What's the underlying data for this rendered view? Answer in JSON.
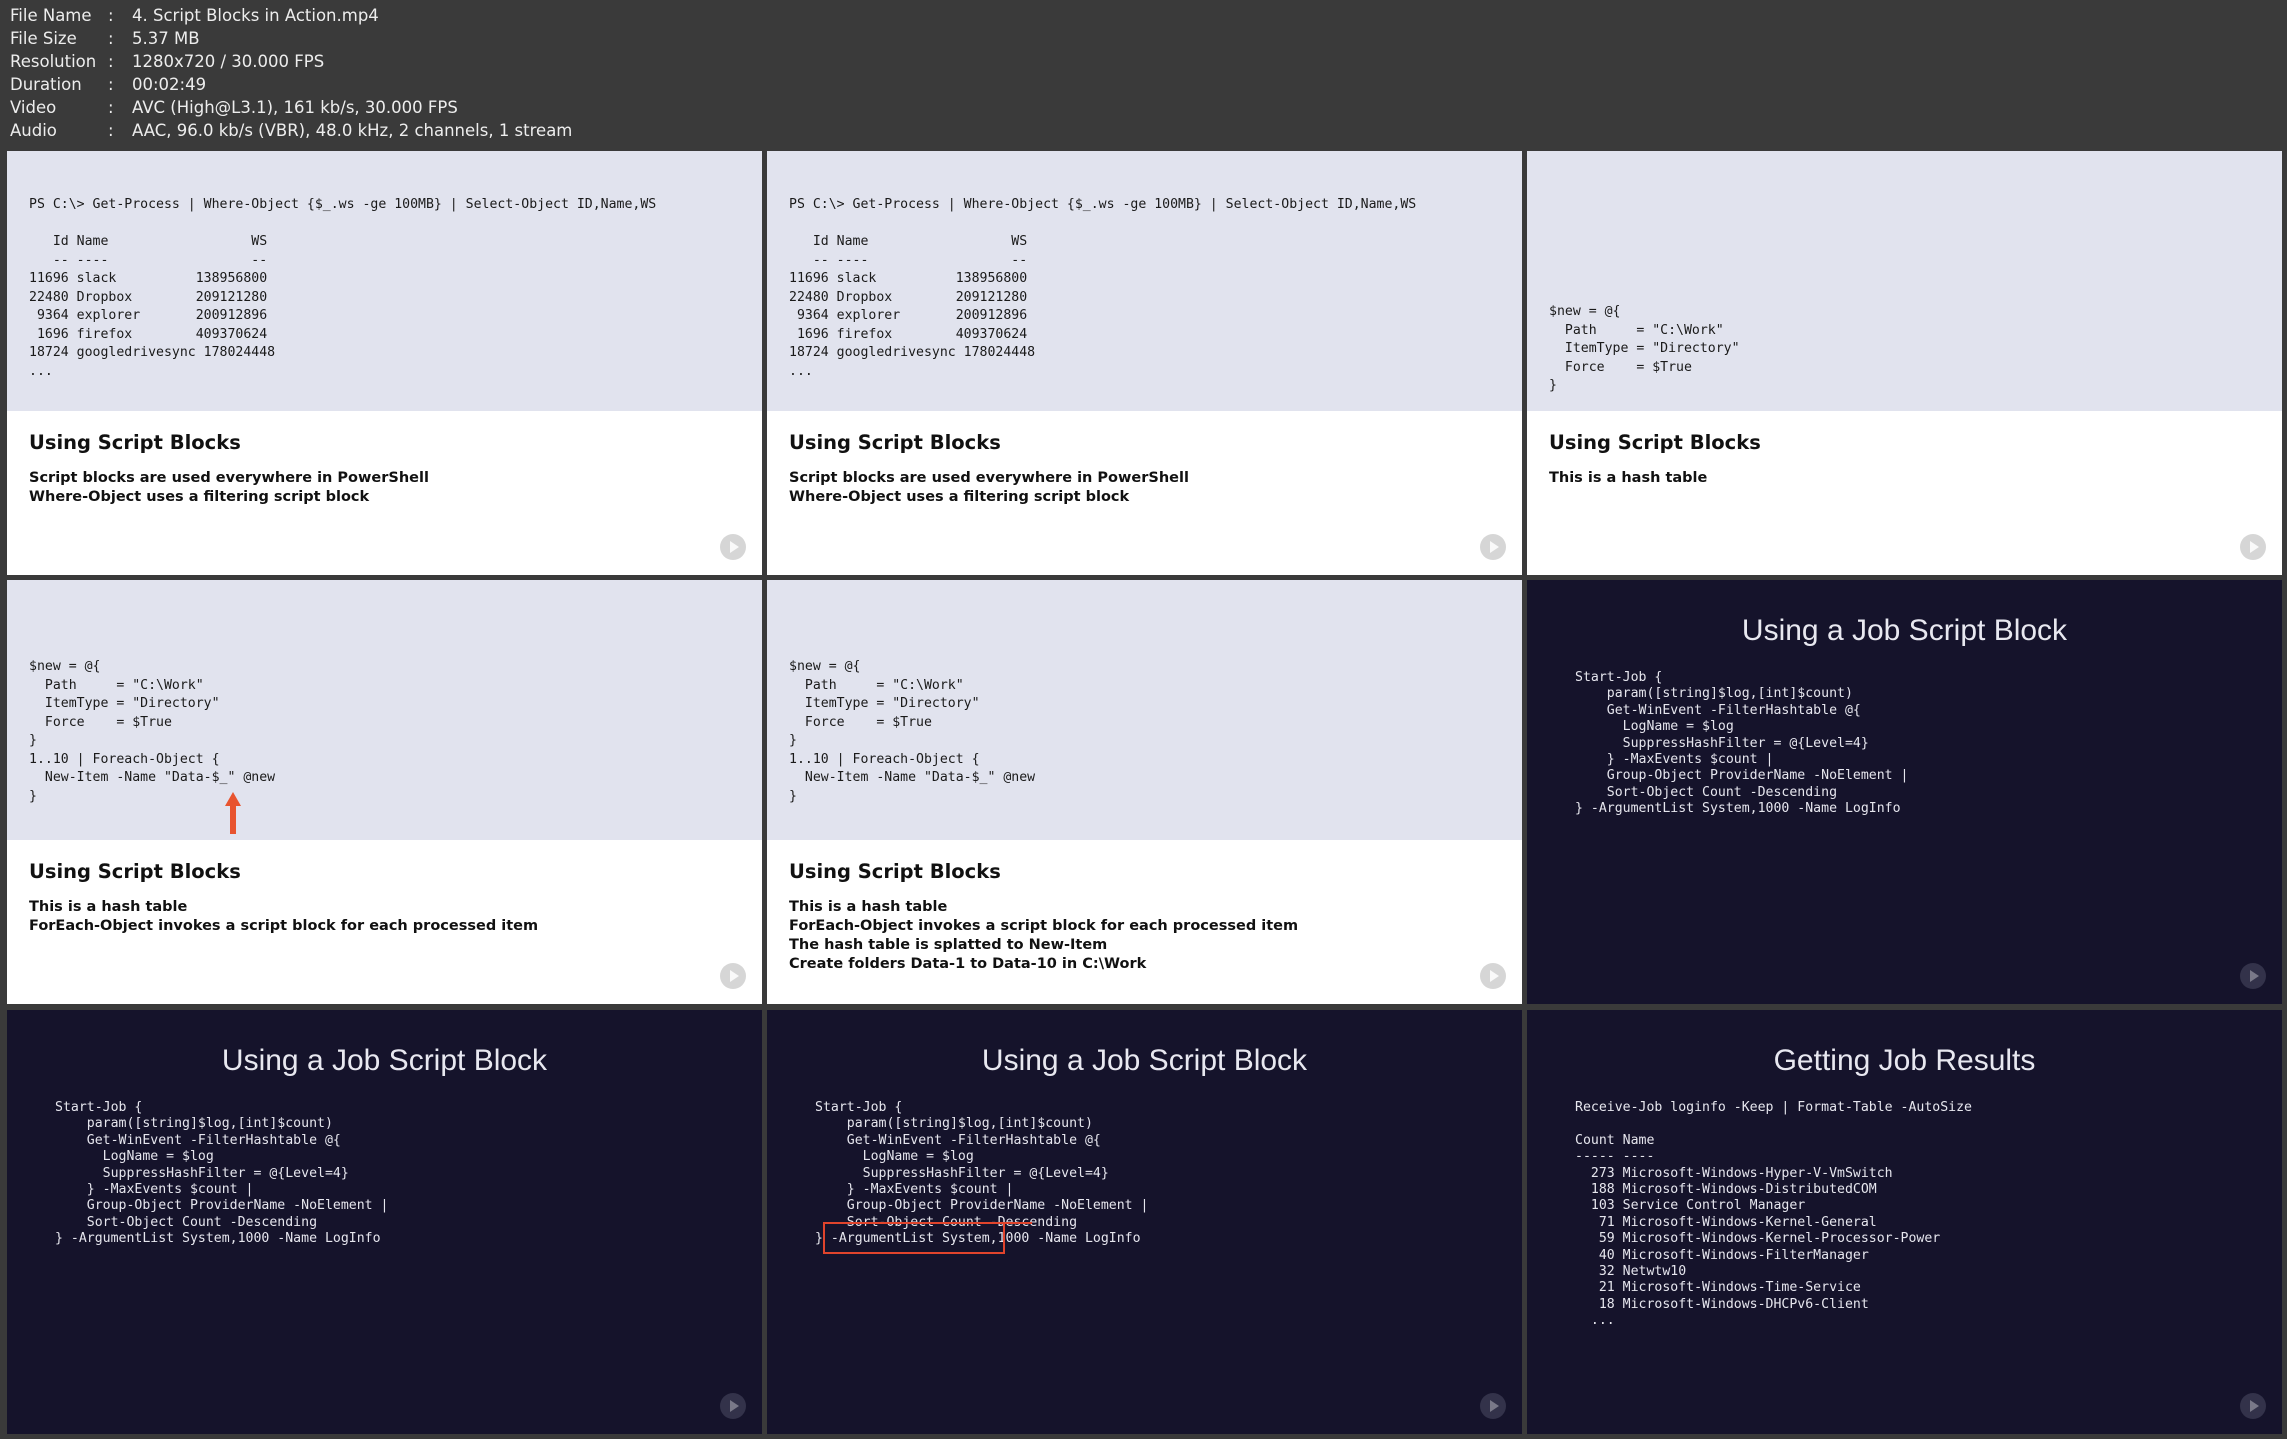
{
  "meta": {
    "rows": [
      {
        "key": "File Name",
        "value": "4. Script Blocks in Action.mp4"
      },
      {
        "key": "File Size",
        "value": "5.37 MB"
      },
      {
        "key": "Resolution",
        "value": "1280x720 / 30.000 FPS"
      },
      {
        "key": "Duration",
        "value": "00:02:49"
      },
      {
        "key": "Video",
        "value": "AVC (High@L3.1), 161 kb/s, 30.000 FPS"
      },
      {
        "key": "Audio",
        "value": "AAC, 96.0 kb/s (VBR), 48.0 kHz, 2 channels, 1 stream"
      }
    ]
  },
  "frames": {
    "f1": {
      "code": "PS C:\\> Get-Process | Where-Object {$_.ws -ge 100MB} | Select-Object ID,Name,WS\n\n   Id Name                  WS\n   -- ----                  --\n11696 slack          138956800\n22480 Dropbox        209121280\n 9364 explorer       200912896\n 1696 firefox        409370624\n18724 googledrivesync 178024448\n...",
      "title": "Using Script Blocks",
      "bullets": "Script blocks are used everywhere in PowerShell\nWhere-Object uses a filtering script block"
    },
    "f2": {
      "code": "PS C:\\> Get-Process | Where-Object {$_.ws -ge 100MB} | Select-Object ID,Name,WS\n\n   Id Name                  WS\n   -- ----                  --\n11696 slack          138956800\n22480 Dropbox        209121280\n 9364 explorer       200912896\n 1696 firefox        409370624\n18724 googledrivesync 178024448\n...",
      "title": "Using Script Blocks",
      "bullets": "Script blocks are used everywhere in PowerShell\nWhere-Object uses a filtering script block"
    },
    "f3": {
      "code": "$new = @{\n  Path     = \"C:\\Work\"\n  ItemType = \"Directory\"\n  Force    = $True\n}",
      "title": "Using Script Blocks",
      "bullets": "This is a hash table"
    },
    "f4": {
      "code": "$new = @{\n  Path     = \"C:\\Work\"\n  ItemType = \"Directory\"\n  Force    = $True\n}\n1..10 | Foreach-Object {\n  New-Item -Name \"Data-$_\" @new\n}",
      "title": "Using Script Blocks",
      "bullets": "This is a hash table\nForEach-Object invokes a script block for each processed item"
    },
    "f5": {
      "code": "$new = @{\n  Path     = \"C:\\Work\"\n  ItemType = \"Directory\"\n  Force    = $True\n}\n1..10 | Foreach-Object {\n  New-Item -Name \"Data-$_\" @new\n}",
      "title": "Using Script Blocks",
      "bullets": "This is a hash table\nForEach-Object invokes a script block for each processed item\nThe hash table is splatted to New-Item\nCreate folders Data-1 to Data-10 in C:\\Work"
    },
    "f6": {
      "title": "Using a Job Script Block",
      "code": "Start-Job {\n    param([string]$log,[int]$count)\n    Get-WinEvent -FilterHashtable @{\n      LogName = $log\n      SuppressHashFilter = @{Level=4}\n    } -MaxEvents $count |\n    Group-Object ProviderName -NoElement |\n    Sort-Object Count -Descending\n} -ArgumentList System,1000 -Name LogInfo"
    },
    "f7": {
      "title": "Using a Job Script Block",
      "code": "Start-Job {\n    param([string]$log,[int]$count)\n    Get-WinEvent -FilterHashtable @{\n      LogName = $log\n      SuppressHashFilter = @{Level=4}\n    } -MaxEvents $count |\n    Group-Object ProviderName -NoElement |\n    Sort-Object Count -Descending\n} -ArgumentList System,1000 -Name LogInfo"
    },
    "f8": {
      "title": "Using a Job Script Block",
      "code": "Start-Job {\n    param([string]$log,[int]$count)\n    Get-WinEvent -FilterHashtable @{\n      LogName = $log\n      SuppressHashFilter = @{Level=4}\n    } -MaxEvents $count |\n    Group-Object ProviderName -NoElement |\n    Sort-Object Count -Descending\n} -ArgumentList System,1000 -Name LogInfo"
    },
    "f9": {
      "title": "Getting Job Results",
      "code": "Receive-Job loginfo -Keep | Format-Table -AutoSize\n\nCount Name\n----- ----\n  273 Microsoft-Windows-Hyper-V-VmSwitch\n  188 Microsoft-Windows-DistributedCOM\n  103 Service Control Manager\n   71 Microsoft-Windows-Kernel-General\n   59 Microsoft-Windows-Kernel-Processor-Power\n   40 Microsoft-Windows-FilterManager\n   32 Netwtw10\n   21 Microsoft-Windows-Time-Service\n   18 Microsoft-Windows-DHCPv6-Client\n  ..."
    }
  },
  "icons": {
    "play": "play-icon",
    "arrow": "arrow-up-icon"
  },
  "colors": {
    "accent": "#e0442c",
    "dark_slide": "#15132b",
    "code_bg": "#e1e3ee"
  }
}
